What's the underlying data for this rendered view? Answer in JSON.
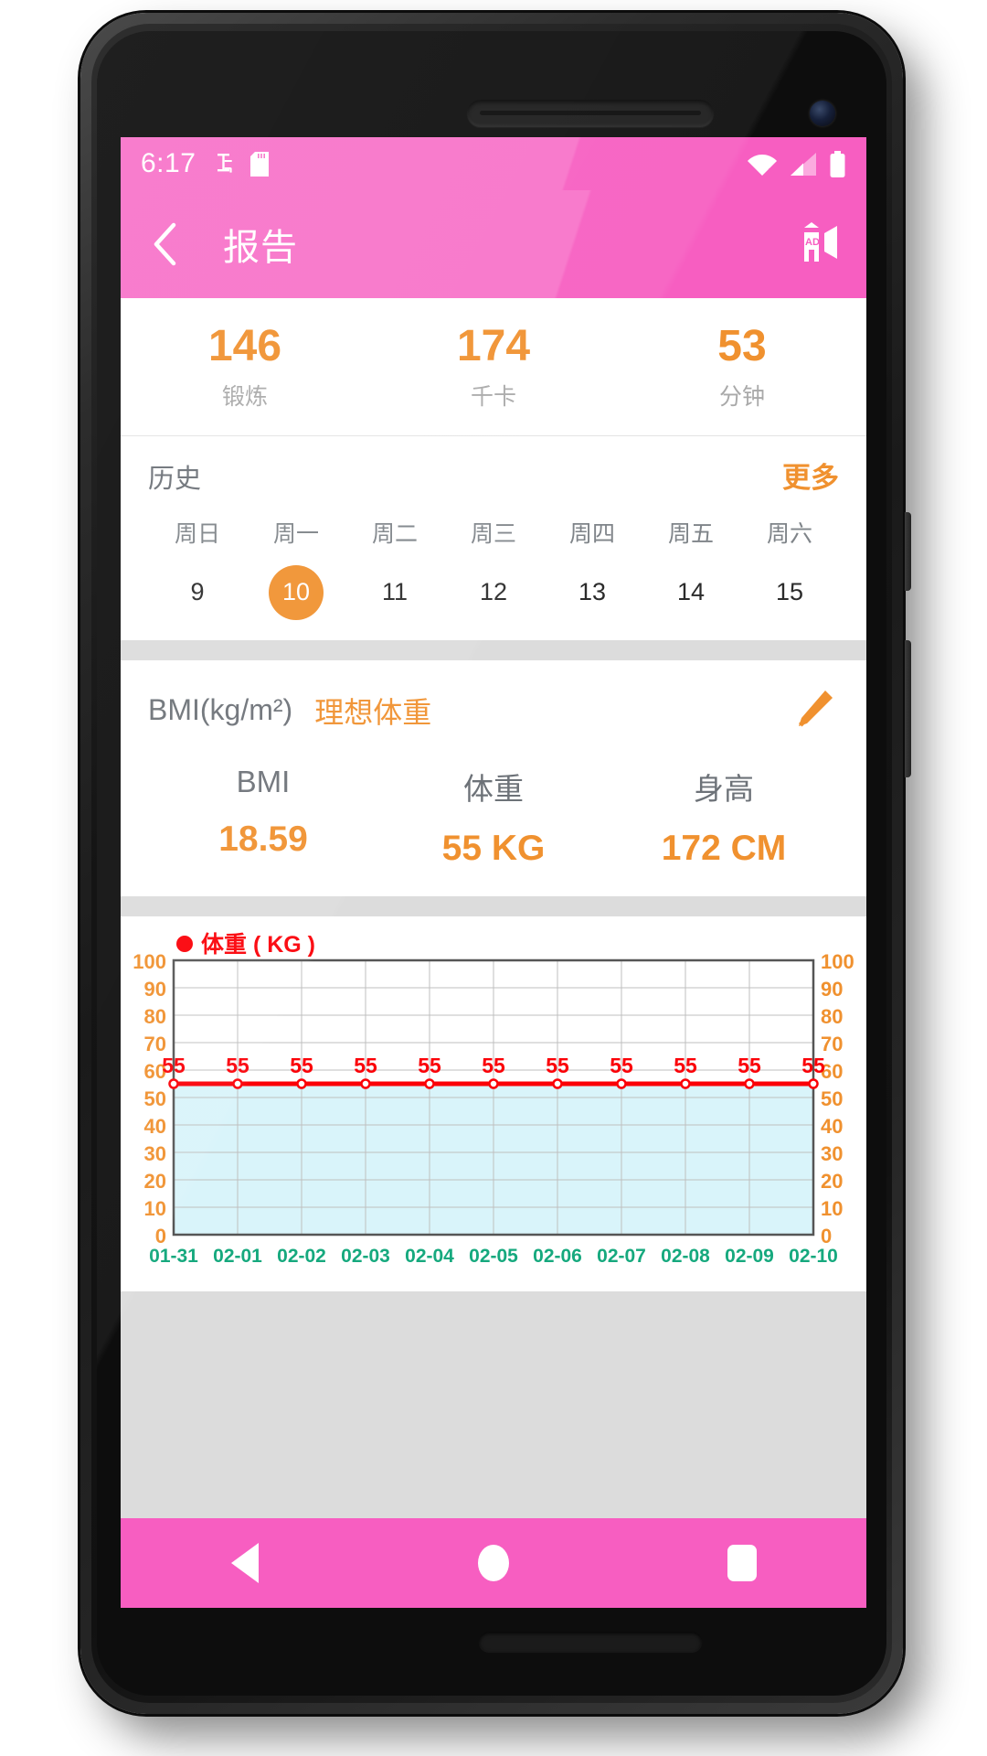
{
  "statusbar": {
    "time": "6:17",
    "icons": [
      "usb-debug-icon",
      "sd-card-icon"
    ],
    "right_icons": [
      "wifi-off-icon",
      "signal-bars-icon",
      "battery-full-icon"
    ]
  },
  "appbar": {
    "back_icon": "chevron-left-icon",
    "title": "报告",
    "ad_icon": "ad-megaphone-icon"
  },
  "stats": [
    {
      "value": "146",
      "label": "锻炼"
    },
    {
      "value": "174",
      "label": "千卡"
    },
    {
      "value": "53",
      "label": "分钟"
    }
  ],
  "history": {
    "title": "历史",
    "more_label": "更多",
    "weekdays": [
      "周日",
      "周一",
      "周二",
      "周三",
      "周四",
      "周五",
      "周六"
    ],
    "dates": [
      "9",
      "10",
      "11",
      "12",
      "13",
      "14",
      "15"
    ],
    "selected_index": 1
  },
  "bmi": {
    "unit_label": "BMI(kg/m²)",
    "ideal_label": "理想体重",
    "edit_icon": "pencil-edit-icon",
    "columns": [
      {
        "key": "BMI",
        "value": "18.59"
      },
      {
        "key": "体重",
        "value": "55 KG"
      },
      {
        "key": "身高",
        "value": "172 CM"
      }
    ]
  },
  "navbar": {
    "back": "nav-back-triangle-icon",
    "home": "nav-home-circle-icon",
    "recents": "nav-recents-square-icon"
  },
  "colors": {
    "pink": "#f75ec1",
    "orange": "#f0912f",
    "red_series": "#fb0007",
    "area_fill": "#d9f4fa",
    "axis_label_x": "#16a97e",
    "gray_divider": "#dcdcdc"
  },
  "chart_data": {
    "type": "line",
    "title": "",
    "legend": {
      "label": "体重 ( KG )",
      "color": "#fb0007",
      "position": "top-left",
      "marker": "circle"
    },
    "x": [
      "01-31",
      "02-01",
      "02-02",
      "02-03",
      "02-04",
      "02-05",
      "02-06",
      "02-07",
      "02-08",
      "02-09",
      "02-10"
    ],
    "series": [
      {
        "name": "体重 ( KG )",
        "values": [
          55,
          55,
          55,
          55,
          55,
          55,
          55,
          55,
          55,
          55,
          55
        ]
      }
    ],
    "point_labels": [
      "55",
      "55",
      "55",
      "55",
      "55",
      "55",
      "55",
      "55",
      "55",
      "55",
      "55"
    ],
    "ylim": [
      0,
      100
    ],
    "yticks": [
      0,
      10,
      20,
      30,
      40,
      50,
      60,
      70,
      80,
      90,
      100
    ],
    "ytick_labels_left": [
      "0",
      "10",
      "20",
      "30",
      "40",
      "50",
      "60",
      "70",
      "80",
      "90",
      "100"
    ],
    "ytick_labels_right": [
      "0",
      "10",
      "20",
      "30",
      "40",
      "50",
      "60",
      "70",
      "80",
      "90",
      "100"
    ],
    "xlabel": "",
    "ylabel": "",
    "grid": true,
    "area_fill_below": true,
    "dual_y_axis": true
  }
}
